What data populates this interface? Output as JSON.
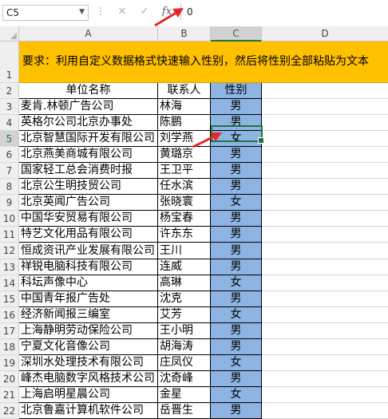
{
  "formula_bar": {
    "name_box": "C5",
    "value": "0",
    "cancel_glyph": "✕",
    "enter_glyph": "✓",
    "fx_glyph": "fx"
  },
  "columns": [
    "A",
    "B",
    "C",
    "D"
  ],
  "selected_column": "C",
  "selected_row": "5",
  "banner_text": "要求：利用自定义数据格式快速输入性别，然后将性别全部粘贴为文本",
  "header_row": {
    "row": "2",
    "unit": "单位名称",
    "contact": "联系人",
    "gender": "性别"
  },
  "rows": [
    {
      "row": "3",
      "unit": "麦肯.林顿广告公司",
      "contact": "林海",
      "gender": "男"
    },
    {
      "row": "4",
      "unit": "英格尔公司北京办事处",
      "contact": "陈鹏",
      "gender": "男"
    },
    {
      "row": "5",
      "unit": "北京智慧国际开发有限公司",
      "contact": "刘学燕",
      "gender": "女"
    },
    {
      "row": "6",
      "unit": "北京燕美商城有限公司",
      "contact": "黄璐京",
      "gender": "男"
    },
    {
      "row": "7",
      "unit": "国家轻工总会消费时报",
      "contact": "王卫平",
      "gender": "男"
    },
    {
      "row": "8",
      "unit": "北京公生明技贸公司",
      "contact": "任水滨",
      "gender": "男"
    },
    {
      "row": "9",
      "unit": "北京英闻广告公司",
      "contact": "张晓寰",
      "gender": "女"
    },
    {
      "row": "10",
      "unit": "中国华安贸易有限公司",
      "contact": "杨宝春",
      "gender": "男"
    },
    {
      "row": "11",
      "unit": "特艺文化用品有限公司",
      "contact": "许东东",
      "gender": "男"
    },
    {
      "row": "12",
      "unit": "恒成资讯产业发展有限公司",
      "contact": "王川",
      "gender": "男"
    },
    {
      "row": "13",
      "unit": "祥锐电脑科技有限公司",
      "contact": "连威",
      "gender": "男"
    },
    {
      "row": "14",
      "unit": "科坛声像中心",
      "contact": "高琳",
      "gender": "女"
    },
    {
      "row": "15",
      "unit": "中国青年报广告处",
      "contact": "沈克",
      "gender": "男"
    },
    {
      "row": "16",
      "unit": "经济新闻报三编室",
      "contact": "艾芳",
      "gender": "女"
    },
    {
      "row": "17",
      "unit": "上海静明劳动保险公司",
      "contact": "王小明",
      "gender": "男"
    },
    {
      "row": "18",
      "unit": "宁夏文化音像公司",
      "contact": "胡海涛",
      "gender": "男"
    },
    {
      "row": "19",
      "unit": "深圳水处理技术有限公司",
      "contact": "庄凤仪",
      "gender": "女"
    },
    {
      "row": "20",
      "unit": "峰杰电脑数字风格技术公司",
      "contact": "沈奇峰",
      "gender": "男"
    },
    {
      "row": "21",
      "unit": "上海启明星晨公司",
      "contact": "金星",
      "gender": "女"
    },
    {
      "row": "22",
      "unit": "北京鲁嘉计算机软件公司",
      "contact": "岳晋生",
      "gender": "男"
    }
  ],
  "colors": {
    "banner": "#ffc000",
    "gender_fill": "#8db4e2",
    "selection": "#217346",
    "arrow": "#e8262a"
  }
}
